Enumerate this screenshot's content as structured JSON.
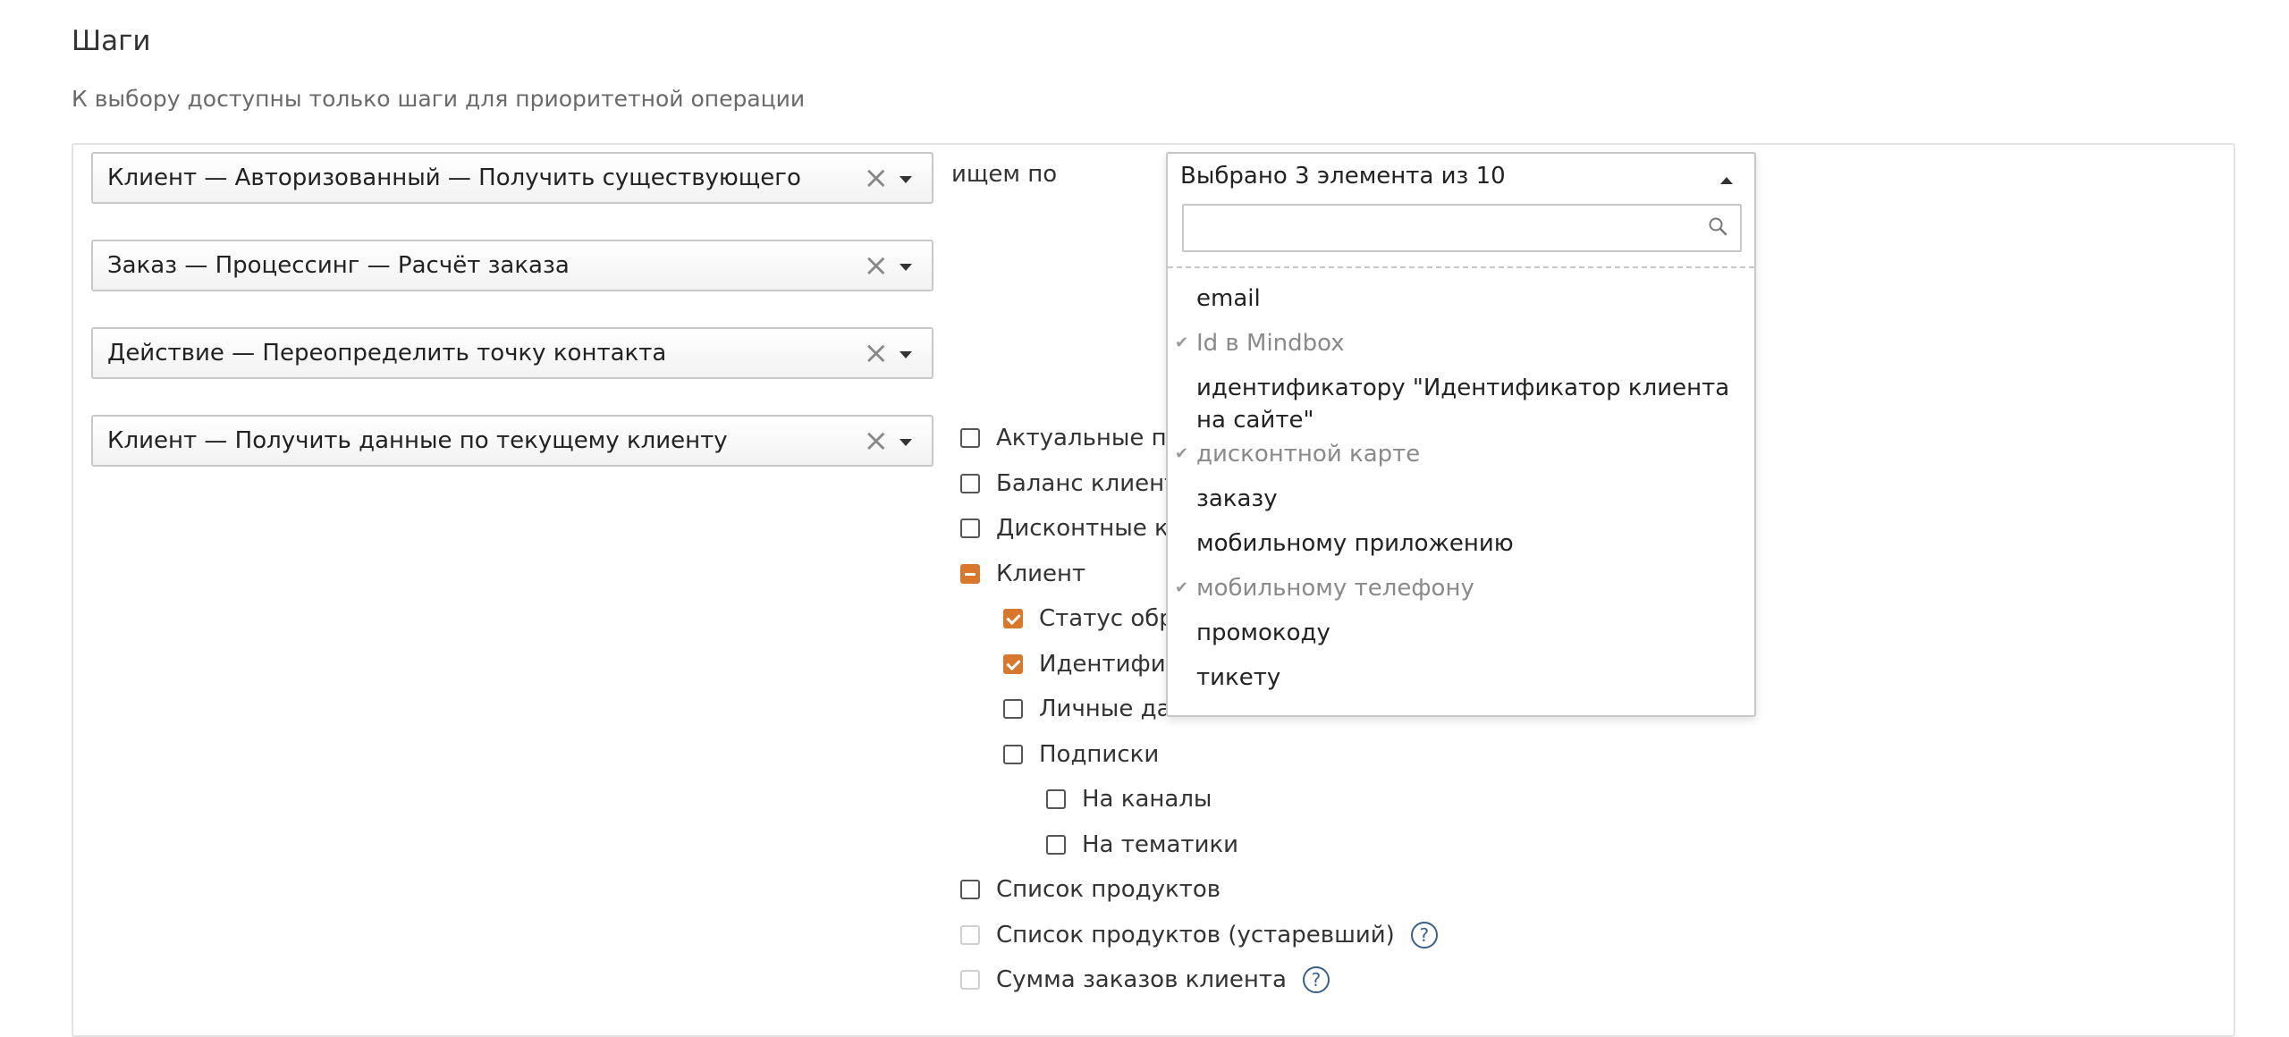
{
  "page": {
    "title": "Шаги",
    "subtitle": "К выбору доступны только шаги для приоритетной операции"
  },
  "steps": [
    {
      "label": "Клиент — Авторизованный — Получить существующего"
    },
    {
      "label": "Заказ — Процессинг — Расчёт заказа"
    },
    {
      "label": "Действие — Переопределить точку контакта"
    },
    {
      "label": "Клиент — Получить данные по текущему клиенту"
    }
  ],
  "search_by": {
    "label": "ищем по",
    "summary": "Выбрано 3 элемента из 10",
    "search_placeholder": "",
    "options": [
      {
        "label": "email",
        "selected": false
      },
      {
        "label": "Id в Mindbox",
        "selected": true
      },
      {
        "label": "идентификатору \"Идентификатор клиента на сайте\"",
        "selected": false
      },
      {
        "label": "дисконтной карте",
        "selected": true
      },
      {
        "label": "заказу",
        "selected": false
      },
      {
        "label": "мобильному приложению",
        "selected": false
      },
      {
        "label": "мобильному телефону",
        "selected": true
      },
      {
        "label": "промокоду",
        "selected": false
      },
      {
        "label": "тикету",
        "selected": false
      }
    ]
  },
  "tree": [
    {
      "label": "Актуальные пер",
      "state": "unchecked",
      "level": 0
    },
    {
      "label": "Баланс клиента",
      "state": "unchecked",
      "level": 0
    },
    {
      "label": "Дисконтные кар",
      "state": "unchecked",
      "level": 0
    },
    {
      "label": "Клиент",
      "state": "partial",
      "level": 0
    },
    {
      "label": "Статус обра",
      "state": "checked",
      "level": 1
    },
    {
      "label": "Идентифика",
      "state": "checked",
      "level": 1
    },
    {
      "label": "Личные дан",
      "state": "unchecked",
      "level": 1
    },
    {
      "label": "Подписки",
      "state": "unchecked",
      "level": 1
    },
    {
      "label": "На каналы",
      "state": "unchecked",
      "level": 2
    },
    {
      "label": "На тематики",
      "state": "unchecked",
      "level": 2
    },
    {
      "label": "Список продуктов",
      "state": "unchecked",
      "level": 0
    },
    {
      "label": "Список продуктов (устаревший)",
      "state": "disabled",
      "level": 0,
      "help": "?"
    },
    {
      "label": "Сумма заказов клиента",
      "state": "disabled",
      "level": 0,
      "help": "?"
    }
  ],
  "colors": {
    "accent": "#d8782c",
    "help": "#3a5f8c"
  }
}
